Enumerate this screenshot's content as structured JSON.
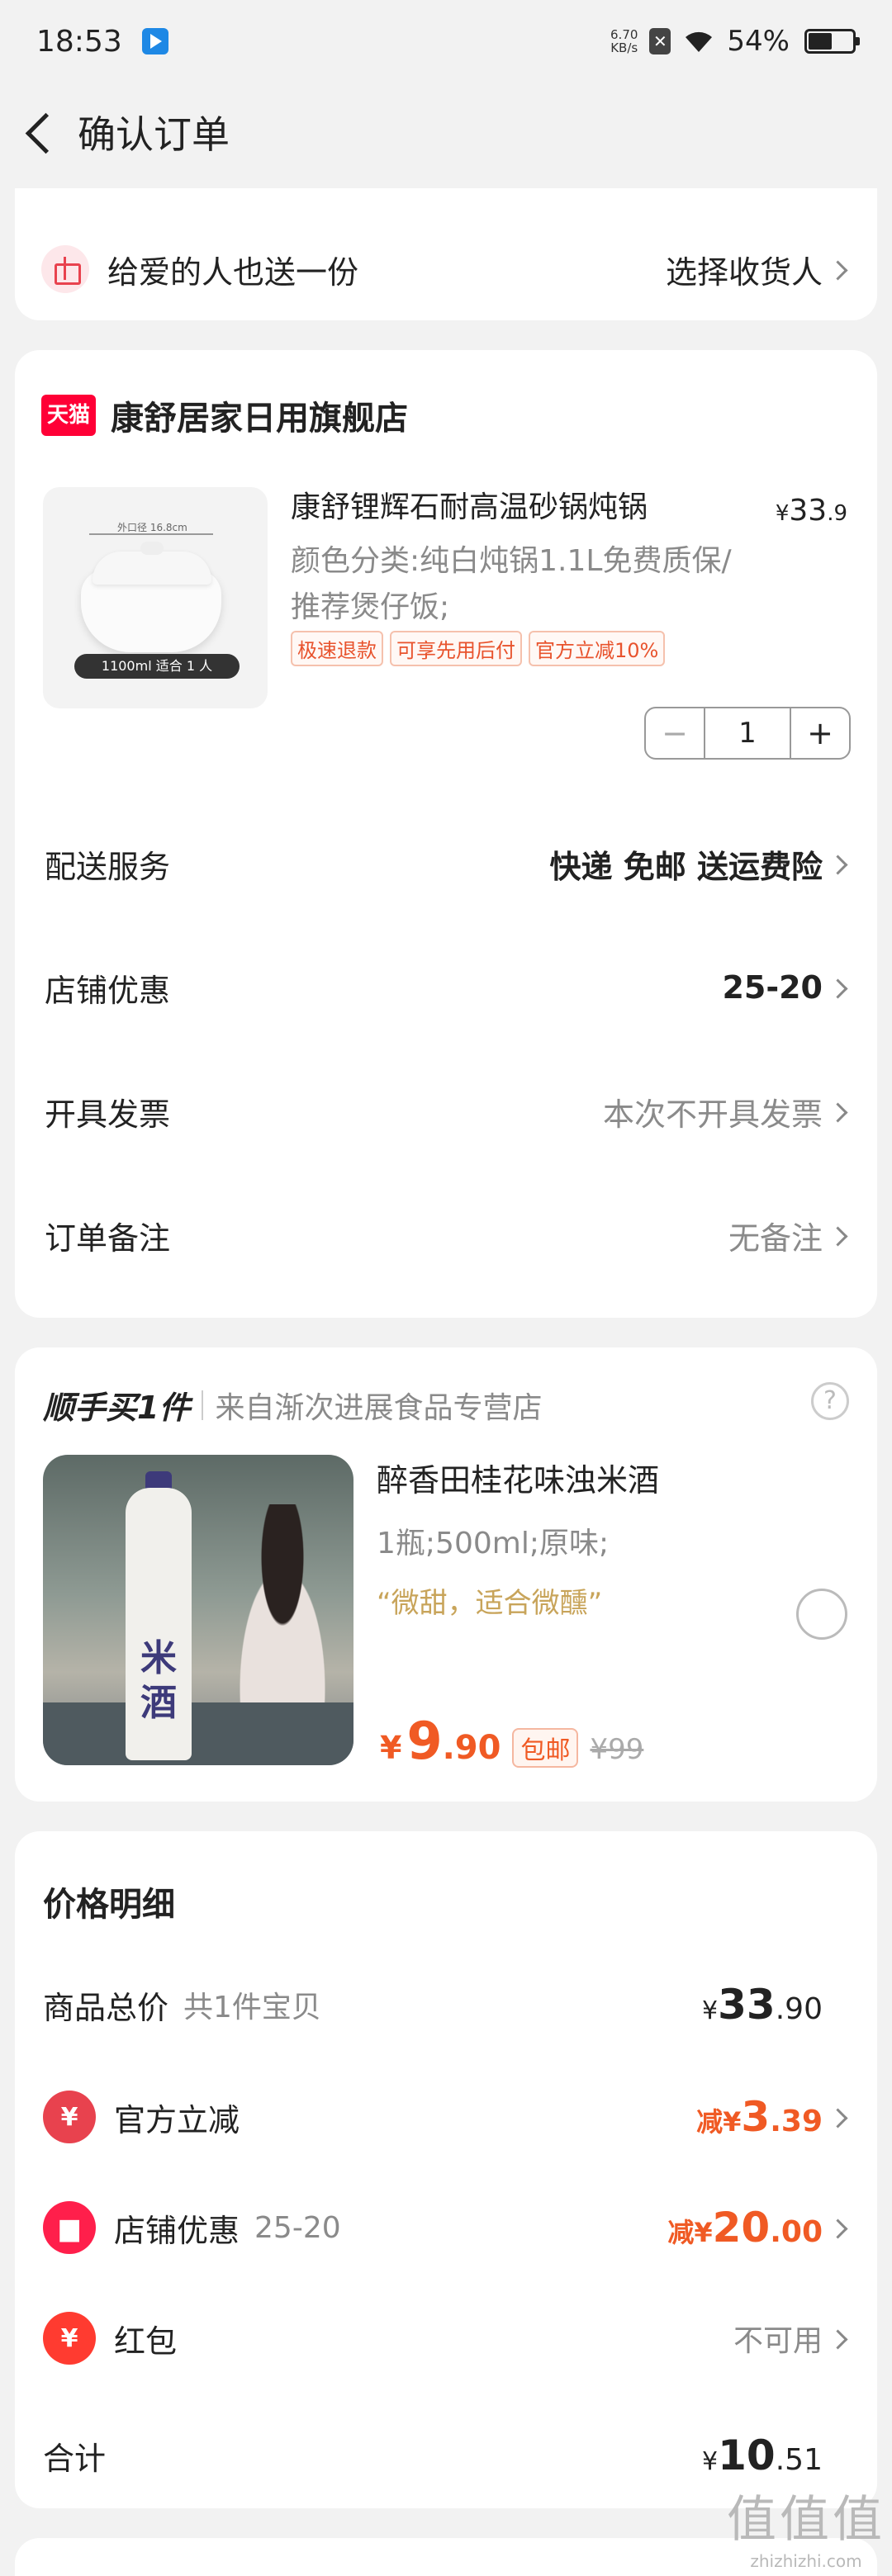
{
  "status_bar": {
    "time": "18:53",
    "net_speed_value": "6.70",
    "net_speed_unit": "KB/s",
    "battery": "54%"
  },
  "header": {
    "title": "确认订单"
  },
  "gift": {
    "label": "给爱的人也送一份",
    "action": "选择收货人"
  },
  "store": {
    "badge": "天猫",
    "name": "康舒居家日用旗舰店",
    "product": {
      "title": "康舒锂辉石耐高温砂锅炖锅",
      "price_symbol": "¥",
      "price_int": "33",
      "price_dec": ".9",
      "spec": "颜色分类:纯白炖锅1.1L免费质保/推荐煲仔饭;",
      "tags": [
        "极速退款",
        "可享先用后付",
        "官方立减10%"
      ],
      "thumb_dim": "外口径 16.8cm",
      "thumb_caption": "1100ml 适合 1 人",
      "quantity": "1"
    },
    "rows": [
      {
        "label": "配送服务",
        "value": "快递 免邮 送运费险"
      },
      {
        "label": "店铺优惠",
        "value": "25-20"
      },
      {
        "label": "开具发票",
        "value": "本次不开具发票"
      },
      {
        "label": "订单备注",
        "value": "无备注"
      }
    ]
  },
  "addon": {
    "title": "顺手买1件",
    "source": "来自渐次进展食品专营店",
    "product_name": "醉香田桂花味浊米酒",
    "spec": "1瓶;500ml;原味;",
    "quote": "“微甜，适合微醺”",
    "price_symbol": "¥",
    "price_int": "9",
    "price_dec": ".90",
    "shipping_tag": "包邮",
    "original_price": "¥99",
    "bottle_label": "米酒"
  },
  "price_detail": {
    "title": "价格明细",
    "subtotal_label": "商品总价",
    "subtotal_note": "共1件宝贝",
    "subtotal_symbol": "¥",
    "subtotal_int": "33",
    "subtotal_dec": ".90",
    "official_label": "官方立减",
    "official_prefix": "减¥",
    "official_int": "3",
    "official_dec": ".39",
    "shop_label": "店铺优惠",
    "shop_note": "25-20",
    "shop_prefix": "减¥",
    "shop_int": "20",
    "shop_dec": ".00",
    "redpacket_label": "红包",
    "redpacket_value": "不可用",
    "total_label": "合计",
    "total_symbol": "¥",
    "total_int": "10",
    "total_dec": ".51"
  },
  "watermark": {
    "big": "值值值",
    "small": "zhizhizhi.com"
  },
  "colors": {
    "accent": "#f05a24",
    "tmall": "#ff0036",
    "background": "#f2f2f2"
  }
}
